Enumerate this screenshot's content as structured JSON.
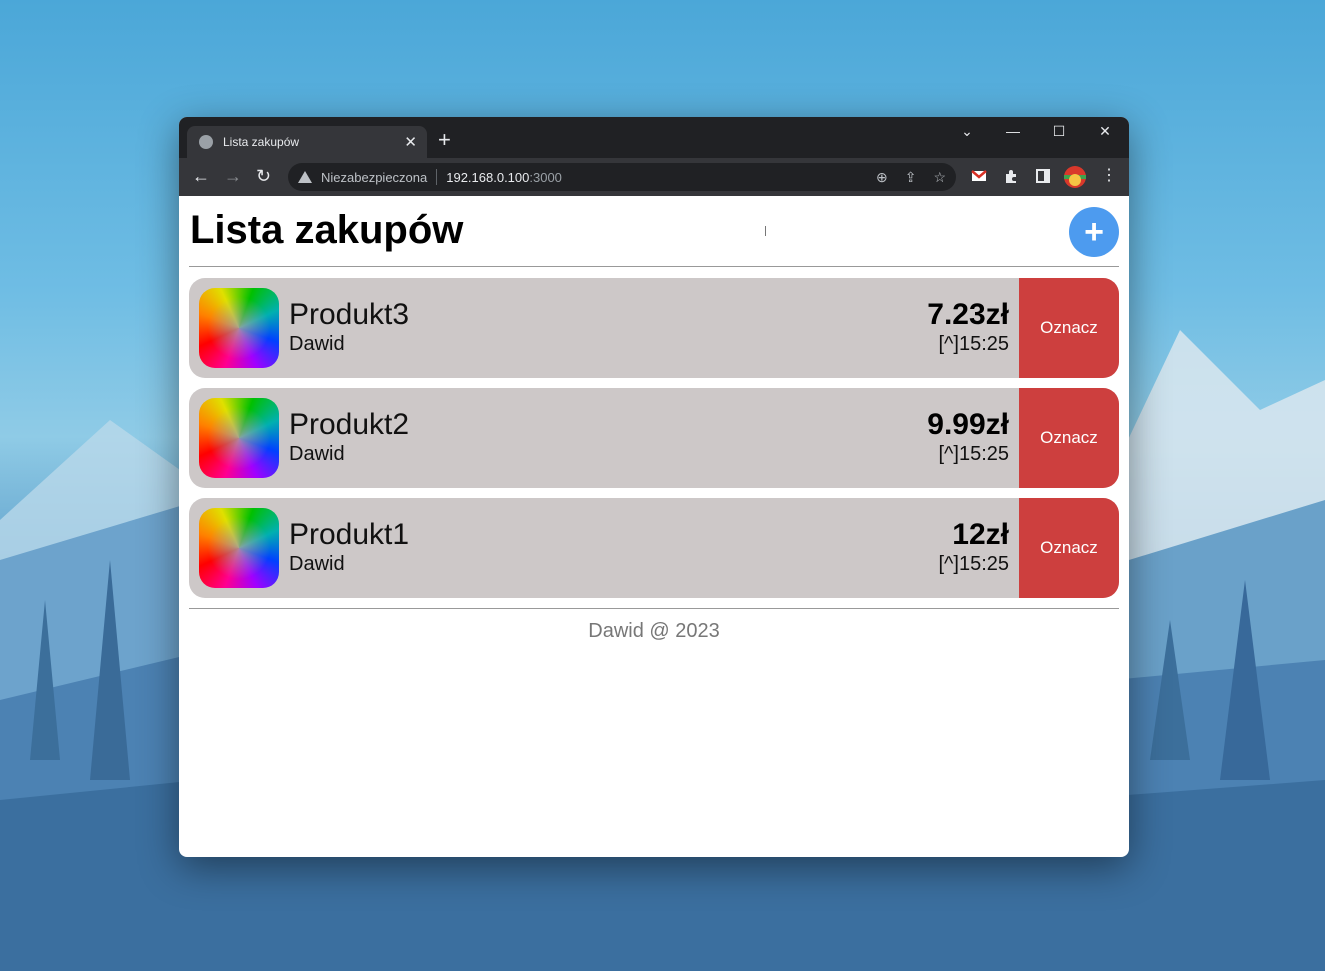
{
  "browser": {
    "tab_title": "Lista zakupów",
    "tab_close": "✕",
    "new_tab": "+",
    "security_label": "Niezabezpieczona",
    "url_host": "192.168.0.100",
    "url_port": ":3000",
    "window_controls": [
      "⌄",
      "—",
      "☐",
      "✕"
    ]
  },
  "app": {
    "title": "Lista zakupów",
    "add_label": "+",
    "products": [
      {
        "name": "Produkt3",
        "user": "Dawid",
        "price": "7.23zł",
        "time": "[^]15:25",
        "action": "Oznacz"
      },
      {
        "name": "Produkt2",
        "user": "Dawid",
        "price": "9.99zł",
        "time": "[^]15:25",
        "action": "Oznacz"
      },
      {
        "name": "Produkt1",
        "user": "Dawid",
        "price": "12zł",
        "time": "[^]15:25",
        "action": "Oznacz"
      }
    ],
    "footer": "Dawid @ 2023"
  },
  "colors": {
    "mark_button": "#cd3f3e",
    "add_button": "#4d9bef",
    "item_background": "#cdc8c8"
  }
}
